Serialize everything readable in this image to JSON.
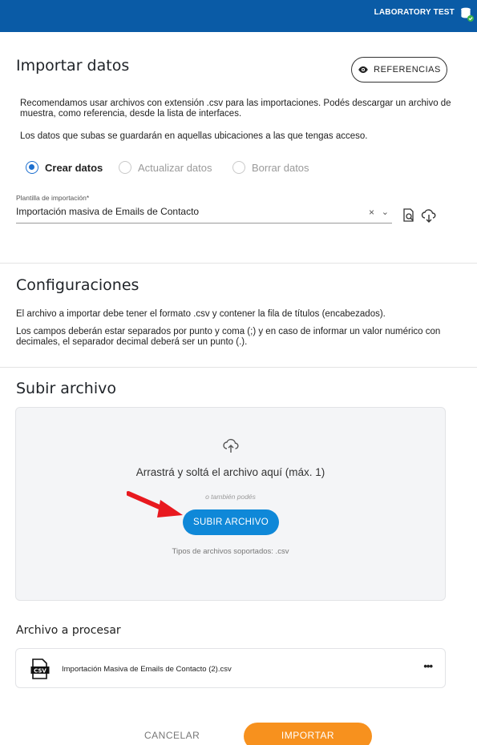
{
  "header": {
    "brand": "LABORATORY TEST",
    "icon": "database-check-icon"
  },
  "import_section": {
    "title": "Importar datos",
    "references_button": "REFERENCIAS",
    "intro_line1": "Recomendamos usar archivos con extensión .csv para las importaciones. Podés descargar un archivo de",
    "intro_line2": "muestra, como referencia, desde la lista de interfaces.",
    "access_note": "Los datos que subas se guardarán en aquellas ubicaciones a las que tengas acceso.",
    "modes": [
      {
        "label": "Crear datos",
        "selected": true
      },
      {
        "label": "Actualizar datos",
        "selected": false
      },
      {
        "label": "Borrar datos",
        "selected": false
      }
    ],
    "template_field": {
      "label": "Plantilla de importación*",
      "value": "Importación masiva de Emails de Contacto",
      "clear_icon": "×",
      "dropdown_icon": "⌄"
    }
  },
  "config_section": {
    "title": "Configuraciones",
    "line1": "El archivo a importar debe tener el formato .csv y contener la fila de títulos (encabezados).",
    "line2": "Los campos deberán estar separados por punto y coma (;) y en caso de informar un valor numérico con",
    "line3": "decimales, el separador decimal deberá ser un punto (.)."
  },
  "upload_section": {
    "title": "Subir archivo",
    "drop_text": "Arrastrá y soltá el archivo aquí (máx. 1)",
    "alt_text": "o también podés",
    "upload_button": "SUBIR ARCHIVO",
    "types_text": "Tipos de archivos soportados: .csv"
  },
  "process_section": {
    "title": "Archivo a procesar",
    "file_name": "Importación Masiva de Emails de Contacto (2).csv",
    "more": "•••"
  },
  "footer": {
    "cancel": "CANCELAR",
    "import": "IMPORTAR"
  },
  "colors": {
    "topbar": "#0a5ba6",
    "primary": "#0f88d8",
    "accent": "#f7911e",
    "arrow": "#e8191f"
  }
}
